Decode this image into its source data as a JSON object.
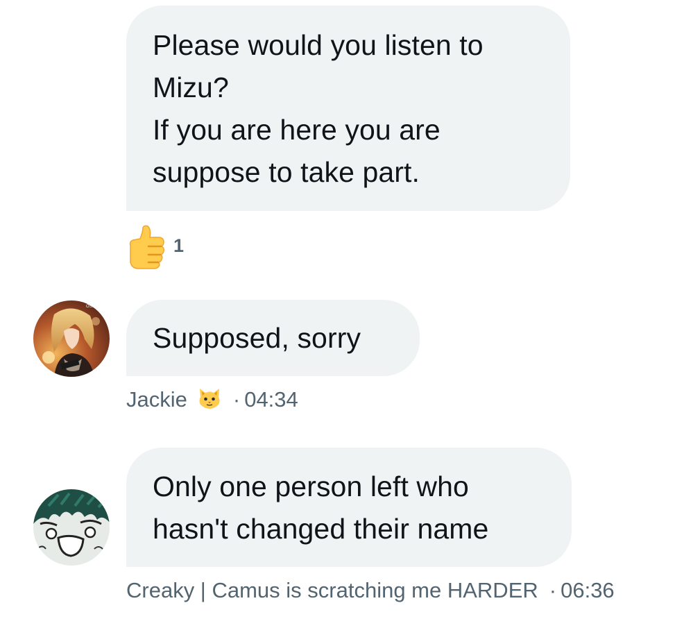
{
  "messages": [
    {
      "text": "Please would you listen to\nMizu?\nIf you are here you are\nsuppose to take part.",
      "reaction": {
        "icon": "thumbs-up-emoji",
        "count": "1"
      }
    },
    {
      "text": "Supposed, sorry",
      "author": {
        "name": "Jackie",
        "badge_icon": "cat-face-emoji"
      },
      "separator": "·",
      "time": "04:34"
    },
    {
      "text": "Only one person left who\nhasn't changed their name",
      "author": {
        "name": "Creaky | Camus is scratching me HARDER"
      },
      "separator": "·",
      "time": "06:36"
    }
  ],
  "colors": {
    "bubble_bg": "#eff3f4",
    "text": "#0f1419",
    "meta_text": "#536471"
  }
}
